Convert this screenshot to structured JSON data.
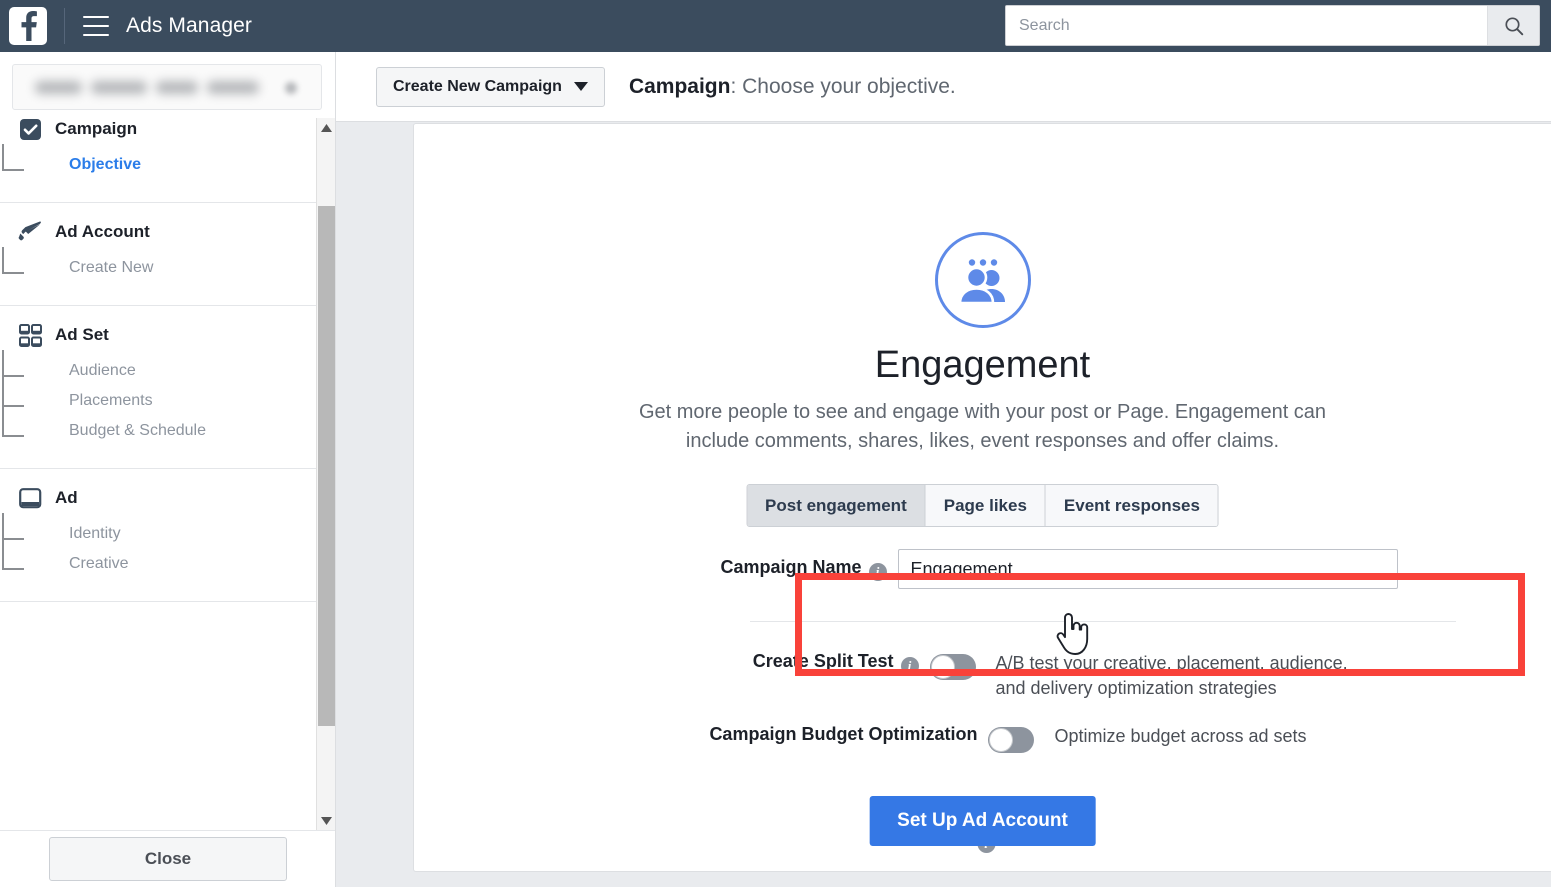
{
  "topbar": {
    "logo_icon": "facebook-logo-icon",
    "menu_icon": "hamburger-menu-icon",
    "app_title": "Ads Manager",
    "search_placeholder": "Search",
    "search_value": "",
    "search_icon": "search-icon"
  },
  "sidebar": {
    "account_selector": {
      "redacted": true,
      "chevron_icon": "chevron-down-icon"
    },
    "groups": [
      {
        "label": "Campaign",
        "icon": "campaign-check-icon",
        "items": [
          {
            "label": "Objective",
            "active": true
          }
        ]
      },
      {
        "label": "Ad Account",
        "icon": "megaphone-icon",
        "items": [
          {
            "label": "Create New",
            "active": false
          }
        ]
      },
      {
        "label": "Ad Set",
        "icon": "grid-squares-icon",
        "items": [
          {
            "label": "Audience",
            "active": false
          },
          {
            "label": "Placements",
            "active": false
          },
          {
            "label": "Budget & Schedule",
            "active": false
          }
        ]
      },
      {
        "label": "Ad",
        "icon": "ad-frame-icon",
        "items": [
          {
            "label": "Identity",
            "active": false
          },
          {
            "label": "Creative",
            "active": false
          }
        ]
      }
    ],
    "close_label": "Close",
    "scroll_up_icon": "scroll-up-arrow-icon",
    "scroll_down_icon": "scroll-down-arrow-icon"
  },
  "breadcrumb": {
    "dropdown_label": "Create New Campaign",
    "dropdown_caret_icon": "caret-down-icon",
    "step_bold": "Campaign",
    "step_rest": ": Choose your objective."
  },
  "objective": {
    "icon": "engagement-people-icon",
    "title": "Engagement",
    "description": "Get more people to see and engage with your post or Page. Engagement can include comments, shares, likes, event responses and offer claims.",
    "tabs": [
      {
        "label": "Post engagement",
        "selected": true
      },
      {
        "label": "Page likes",
        "selected": false
      },
      {
        "label": "Event responses",
        "selected": false
      }
    ]
  },
  "form": {
    "campaign_name": {
      "label": "Campaign Name",
      "info_icon": "info-icon",
      "value": "Engagement",
      "placeholder": ""
    },
    "split_test": {
      "label": "Create Split Test",
      "info_icon": "info-icon",
      "toggle_state": "off",
      "description": "A/B test your creative, placement, audience, and delivery optimization strategies"
    },
    "budget_optimization": {
      "label": "Campaign Budget Optimization",
      "info_icon": "info-icon",
      "toggle_state": "off",
      "description": "Optimize budget across ad sets"
    },
    "submit_label": "Set Up Ad Account"
  },
  "annotation": {
    "highlight_color": "#f9423a",
    "cursor_icon": "hand-pointer-cursor-icon"
  },
  "colors": {
    "topbar": "#3b4c5e",
    "accent_blue": "#3578e5",
    "link_blue": "#2b7de9",
    "page_bg": "#e9ebee"
  }
}
